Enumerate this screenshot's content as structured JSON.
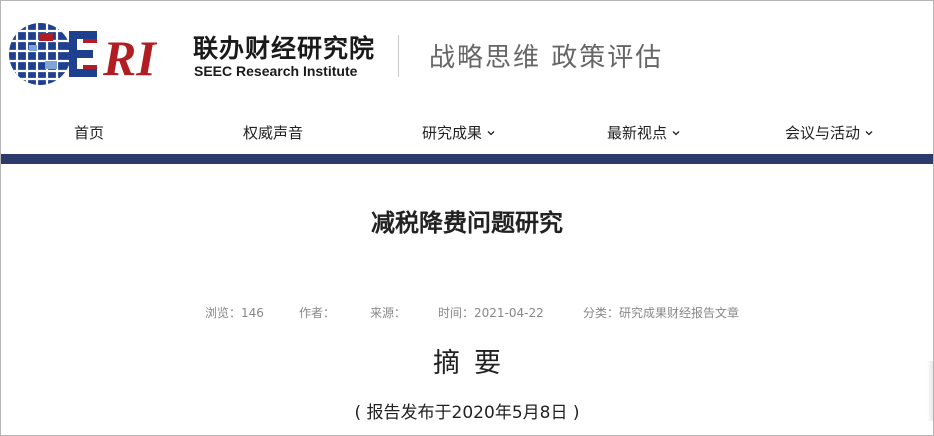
{
  "brand": {
    "logo_text": "ESRI",
    "name_cn": "联办财经研究院",
    "name_en": "SEEC Research Institute",
    "slogan": "战略思维  政策评估",
    "colors": {
      "logo_blue": "#1f3f8f",
      "logo_red": "#b01e23",
      "nav_bar": "#2c3b6c"
    }
  },
  "nav": {
    "items": [
      {
        "label": "首页",
        "has_dropdown": false
      },
      {
        "label": "权威声音",
        "has_dropdown": false
      },
      {
        "label": "研究成果",
        "has_dropdown": true
      },
      {
        "label": "最新视点",
        "has_dropdown": true
      },
      {
        "label": "会议与活动",
        "has_dropdown": true
      }
    ]
  },
  "article": {
    "title": "减税降费问题研究",
    "meta": {
      "views": "浏览：146",
      "author": "作者：",
      "source": "来源：",
      "time": "时间：2021-04-22",
      "category": "分类：研究成果财经报告文章"
    },
    "section_title": "摘要",
    "publish_note": "( 报告发布于2020年5月8日 )"
  },
  "icons": {
    "dropdown": "chevron-down-icon"
  }
}
